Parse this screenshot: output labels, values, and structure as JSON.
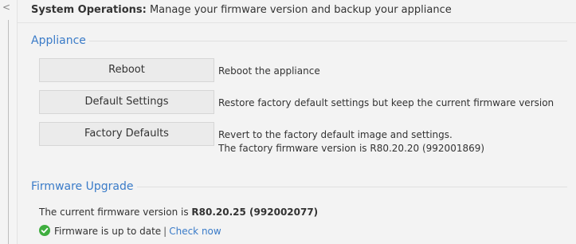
{
  "left_panel": {
    "collapse_glyph": "<"
  },
  "header": {
    "title": "System Operations:",
    "description": "Manage your firmware version and backup your appliance"
  },
  "appliance": {
    "section_title": "Appliance",
    "reboot": {
      "button_label": "Reboot",
      "description": "Reboot the appliance"
    },
    "default_settings": {
      "button_label": "Default Settings",
      "description": "Restore factory default settings but keep the current firmware version"
    },
    "factory_defaults": {
      "button_label": "Factory Defaults",
      "description_line1": "Revert to the factory default image and settings.",
      "description_line2": "The factory firmware version is R80.20.20 (992001869)"
    }
  },
  "firmware_upgrade": {
    "section_title": "Firmware Upgrade",
    "current_prefix": "The current firmware version is",
    "current_version": "R80.20.25 (992002077)",
    "status_icon": "check-circle-icon",
    "status_text": "Firmware is up to date",
    "separator": "|",
    "check_now_label": "Check now"
  },
  "colors": {
    "accent": "#3a7bc8",
    "success": "#3fae3f",
    "button_bg": "#ebebeb",
    "panel_bg": "#f3f3f3"
  }
}
